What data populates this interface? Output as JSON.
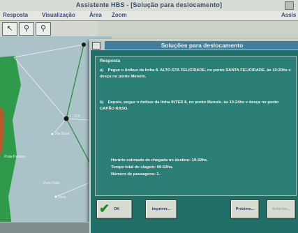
{
  "window": {
    "title": "Assistente HBS - [Solução para deslocamento]",
    "right_label": "Assis"
  },
  "menu": {
    "items": [
      "Resposta",
      "Visualização",
      "Área",
      "Zoom"
    ],
    "right_label": "Assis"
  },
  "toolbar": {
    "tools": [
      "pointer-tool-icon",
      "zoom-in-icon",
      "zoom-out-icon"
    ]
  },
  "map": {
    "labels": {
      "stop_a": "L. COI",
      "stop_b": "Vila Nova",
      "stop_c": "Porto Feliz",
      "stop_d": "Praia Paraíso",
      "stop_e": "Ilhas"
    }
  },
  "dialog": {
    "title": "Soluções para deslocamento",
    "panel_label": "Resposta",
    "steps": [
      {
        "mark": "a)",
        "text": "Pegue o ônibus da linha 8. ALTO-STA FELICIDADE, no ponto SANTA FELICIDADE, às 10:20hs e desça no ponto Menolo."
      },
      {
        "mark": "b)",
        "text": "Depois, pegue o ônibus da linha INTER 8, no ponto Menolo, às 10:24hs e desça no ponto CAPÃO RASO."
      }
    ],
    "summary": [
      "Horário estimado de chegada no destino: 10:32hs.",
      "Tempo total de viagem: 00:12hs.",
      "Número de passagens: 1."
    ],
    "buttons": {
      "ok": "OK",
      "print": "Imprimir...",
      "next": "Próximo...",
      "prev": "Anterior..."
    }
  }
}
